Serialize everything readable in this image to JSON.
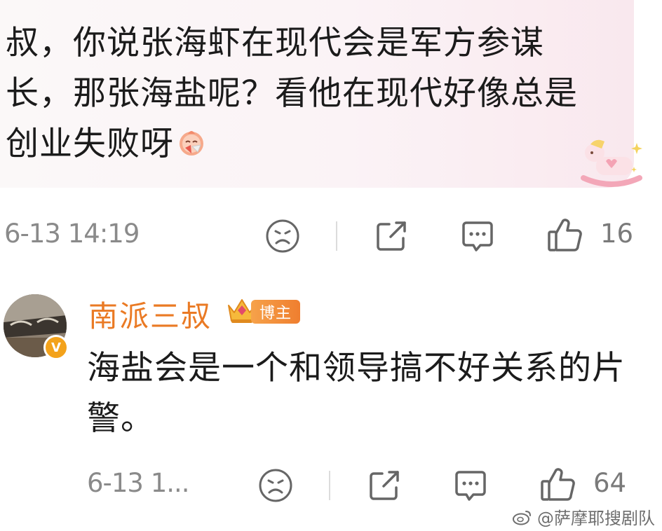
{
  "comment": {
    "text": "叔，你说张海虾在现代会是军方参谋长，那张海盐呢？看他在现代好像总是创业失败呀",
    "emoji_icon": "laughing-chick-emoji-icon",
    "timestamp": "6-13 14:19",
    "like_count": "16"
  },
  "reply": {
    "username": "南派三叔",
    "author_tag": "博主",
    "verified_badge": "V",
    "text": "海盐会是一个和领导搞不好关系的片警。",
    "timestamp": "6-13 1...",
    "like_count": "64"
  },
  "watermark": {
    "text": "@萨摩耶搜剧队"
  },
  "colors": {
    "username": "#ea7a24",
    "tag_bg": "#f08a35",
    "timestamp": "#8a8a8a",
    "icon": "#666666"
  }
}
